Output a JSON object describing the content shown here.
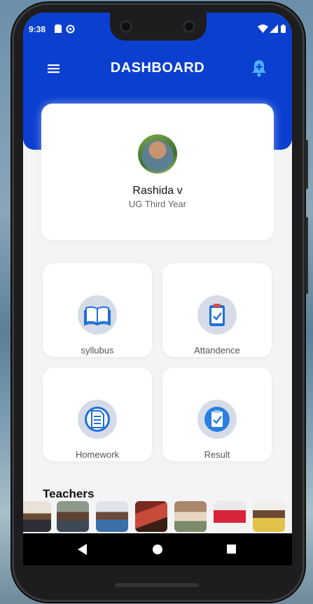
{
  "statusbar": {
    "time": "9:38"
  },
  "appbar": {
    "title": "DASHBOARD"
  },
  "profile": {
    "name": "Rashida v",
    "year": "UG Third Year"
  },
  "tiles": [
    {
      "label": "syllubus",
      "icon": "book-icon"
    },
    {
      "label": "Attandence",
      "icon": "attendance-icon"
    },
    {
      "label": "Homework",
      "icon": "homework-icon"
    },
    {
      "label": "Result",
      "icon": "result-icon"
    }
  ],
  "teachers": {
    "title": "Teachers"
  },
  "colors": {
    "primary": "#0a3fd0",
    "background": "#f4f4f6",
    "tile_circle": "#d6dce7"
  }
}
